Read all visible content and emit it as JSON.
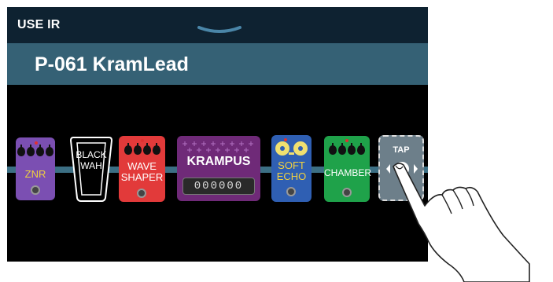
{
  "header": {
    "mode_label": "USE IR"
  },
  "patch": {
    "name": "P-061 KramLead"
  },
  "pedals": [
    {
      "name": "ZNR",
      "color": "#7b4fb2",
      "text_color": "#f0d040"
    },
    {
      "name": "BLACK WAH",
      "line1": "BLACK",
      "line2": "WAH",
      "color": "#000000",
      "text_color": "#ffffff"
    },
    {
      "name": "WAVE SHAPER",
      "line1": "WAVE",
      "line2": "SHAPER",
      "color": "#e23a3a",
      "text_color": "#ffffff"
    },
    {
      "name": "KRAMPUS",
      "color": "#6f2a78",
      "text_color": "#ffffff",
      "digits": "000000"
    },
    {
      "name": "SOFT ECHO",
      "line1": "SOFT",
      "line2": "ECHO",
      "color": "#2f5fb3",
      "text_color": "#f0d040"
    },
    {
      "name": "CHAMBER",
      "color": "#1fa24a",
      "text_color": "#ffffff"
    }
  ],
  "tap": {
    "label": "TAP",
    "add_icon": "plus-icon",
    "left_icon": "chevron-left-icon",
    "right_icon": "chevron-right-icon"
  },
  "colors": {
    "screen_bg": "#000000",
    "header_bg": "#0e2231",
    "title_bg": "#356175",
    "cable": "#3c6f84"
  }
}
